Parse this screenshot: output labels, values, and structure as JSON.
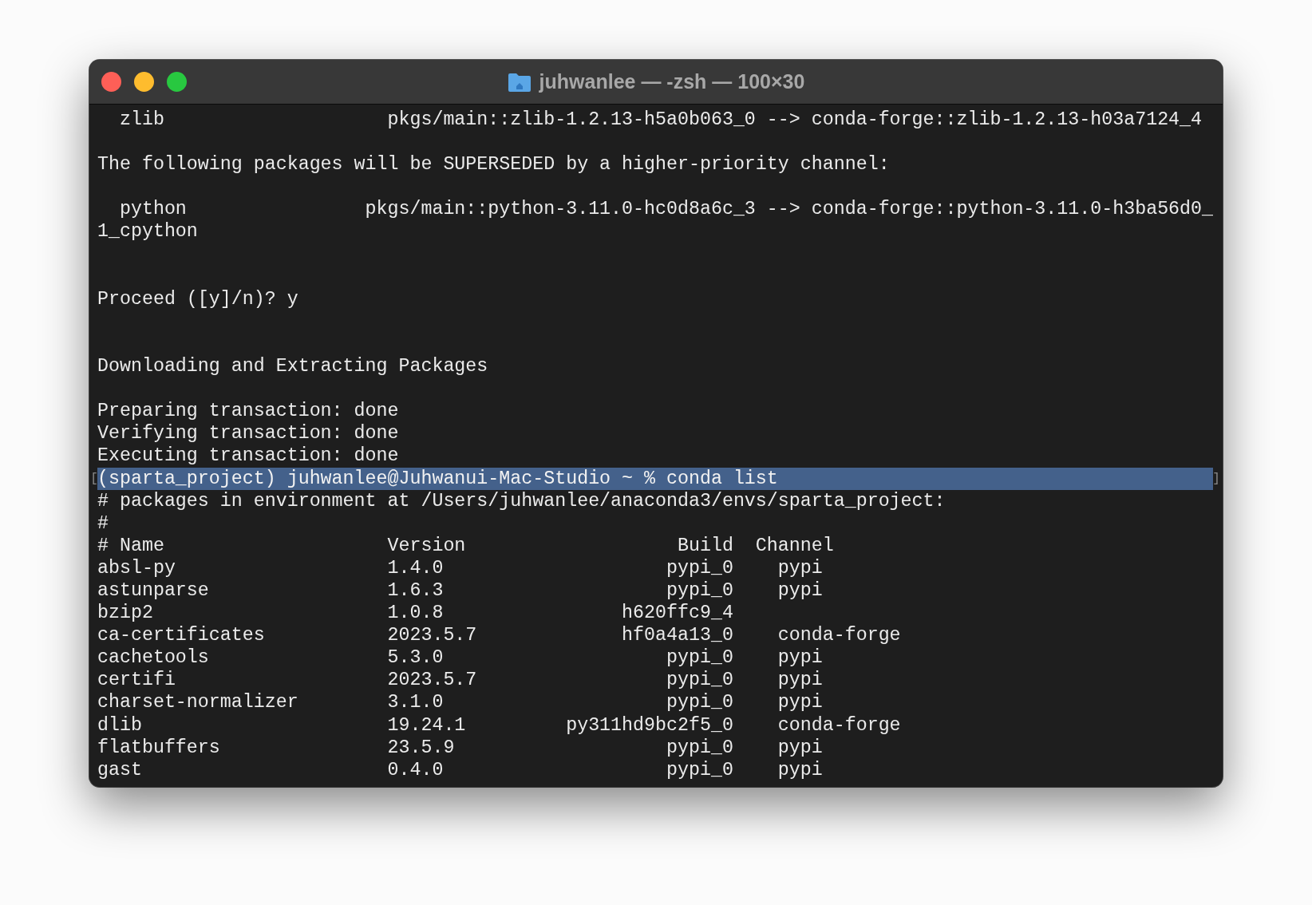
{
  "window": {
    "title": "juhwanlee — -zsh — 100×30"
  },
  "terminal": {
    "lines": [
      {
        "kind": "text",
        "text": "  zlib                    pkgs/main::zlib-1.2.13-h5a0b063_0 --> conda-forge::zlib-1.2.13-h03a7124_4"
      },
      {
        "kind": "blank"
      },
      {
        "kind": "text",
        "text": "The following packages will be SUPERSEDED by a higher-priority channel:"
      },
      {
        "kind": "blank"
      },
      {
        "kind": "text",
        "text": "  python                pkgs/main::python-3.11.0-hc0d8a6c_3 --> conda-forge::python-3.11.0-h3ba56d0_"
      },
      {
        "kind": "text",
        "text": "1_cpython"
      },
      {
        "kind": "blank"
      },
      {
        "kind": "blank"
      },
      {
        "kind": "text",
        "text": "Proceed ([y]/n)? y"
      },
      {
        "kind": "blank"
      },
      {
        "kind": "blank"
      },
      {
        "kind": "text",
        "text": "Downloading and Extracting Packages"
      },
      {
        "kind": "blank"
      },
      {
        "kind": "text",
        "text": "Preparing transaction: done"
      },
      {
        "kind": "text",
        "text": "Verifying transaction: done"
      },
      {
        "kind": "text",
        "text": "Executing transaction: done"
      },
      {
        "kind": "marked",
        "text": "(sparta_project) juhwanlee@Juhwanui-Mac-Studio ~ % conda list",
        "marker_left": "[",
        "marker_right": "]"
      },
      {
        "kind": "text",
        "text": "# packages in environment at /Users/juhwanlee/anaconda3/envs/sparta_project:"
      },
      {
        "kind": "text",
        "text": "#"
      }
    ]
  },
  "table": {
    "columns": [
      "# Name",
      "Version",
      "Build",
      "Channel"
    ],
    "rows": [
      {
        "name": "absl-py",
        "version": "1.4.0",
        "build": "pypi_0",
        "channel": "pypi"
      },
      {
        "name": "astunparse",
        "version": "1.6.3",
        "build": "pypi_0",
        "channel": "pypi"
      },
      {
        "name": "bzip2",
        "version": "1.0.8",
        "build": "h620ffc9_4"
      },
      {
        "name": "ca-certificates",
        "version": "2023.5.7",
        "build": "hf0a4a13_0",
        "channel": "conda-forge"
      },
      {
        "name": "cachetools",
        "version": "5.3.0",
        "build": "pypi_0",
        "channel": "pypi"
      },
      {
        "name": "certifi",
        "version": "2023.5.7",
        "build": "pypi_0",
        "channel": "pypi"
      },
      {
        "name": "charset-normalizer",
        "version": "3.1.0",
        "build": "pypi_0",
        "channel": "pypi"
      },
      {
        "name": "dlib",
        "version": "19.24.1",
        "build": "py311hd9bc2f5_0",
        "channel": "conda-forge"
      },
      {
        "name": "flatbuffers",
        "version": "23.5.9",
        "build": "pypi_0",
        "channel": "pypi"
      },
      {
        "name": "gast",
        "version": "0.4.0",
        "build": "pypi_0",
        "channel": "pypi"
      }
    ]
  }
}
